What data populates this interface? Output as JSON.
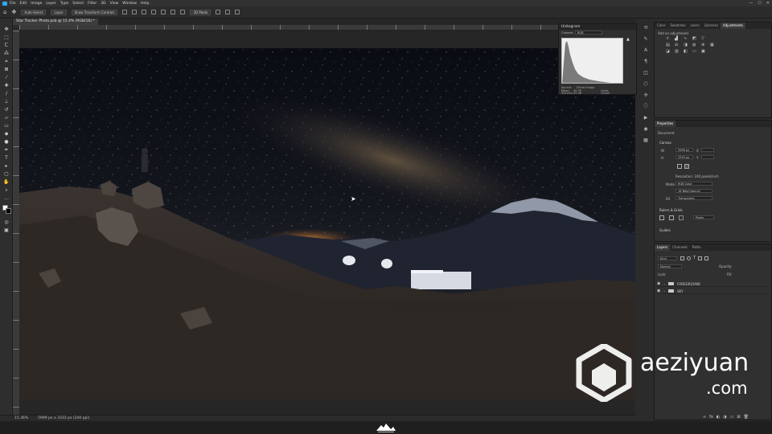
{
  "menu": {
    "items": [
      "File",
      "Edit",
      "Image",
      "Layer",
      "Type",
      "Select",
      "Filter",
      "3D",
      "View",
      "Window",
      "Help"
    ],
    "window_controls": [
      "—",
      "☐",
      "✕"
    ]
  },
  "options_bar": {
    "auto_select_label": "Auto-Select",
    "auto_select_value": "Layer",
    "transform_label": "Show Transform Controls",
    "mode_3d": "3D Mode"
  },
  "document": {
    "tab_title": "Star Tracker Photo.psb @ 15.4% (RGB/16) *",
    "zoom": "15.36%",
    "doc_size": "5999 px x 3333 px (240 ppi)"
  },
  "histogram": {
    "title": "Histogram",
    "channel_label": "Channel:",
    "channel_value": "RGB",
    "source_label": "Source:",
    "source_value": "Entire Image",
    "stats_left": [
      "Mean:",
      "Std Dev:",
      "Median:",
      "Pixels:"
    ],
    "stats_left_vals": [
      "40.35",
      "32.96",
      "31",
      "9996921"
    ],
    "stats_right": [
      "Level:",
      "Count:",
      "Percentile:",
      "Cache Level:"
    ],
    "stats_right_vals": [
      "",
      "",
      "",
      "6"
    ]
  },
  "adjustments": {
    "tabs": [
      "Color",
      "Swatches",
      "Learn",
      "Libraries",
      "Adjustments"
    ],
    "active_tab": "Adjustments",
    "add_label": "Add an adjustment"
  },
  "properties": {
    "title": "Properties",
    "doc_label": "Document",
    "canvas_title": "Canvas",
    "width_label": "W",
    "width_value": "5999 px",
    "height_label": "H",
    "height_value": "3333 px",
    "x_label": "X",
    "y_label": "Y",
    "resolution": "Resolution: 240 pixels/inch",
    "mode_label": "Mode",
    "mode_value": "RGB Color",
    "depth_value": "16 Bits/Channel",
    "fill_label": "Fill",
    "fill_value": "Transparent",
    "rulers_title": "Rulers & Grids",
    "units_value": "Pixels",
    "guides_title": "Guides"
  },
  "layers": {
    "tabs": [
      "Layers",
      "Channels",
      "Paths"
    ],
    "active_tab": "Layers",
    "kind_label": "Kind",
    "blend_value": "Normal",
    "opacity_label": "Opacity:",
    "fill_label": "Fill:",
    "lock_label": "Lock:",
    "rows": [
      {
        "name": "FOREGROUND",
        "type": "group"
      },
      {
        "name": "SKY",
        "type": "group"
      }
    ]
  },
  "watermark": {
    "line1": "aeziyuan",
    "line2": ".com"
  },
  "tools": [
    "move",
    "marquee",
    "lasso",
    "magic-wand",
    "crop",
    "frame",
    "eyedropper",
    "healing",
    "brush",
    "clone-stamp",
    "history-brush",
    "eraser",
    "gradient",
    "blur",
    "dodge",
    "pen",
    "type",
    "path-select",
    "rectangle",
    "hand",
    "zoom",
    "more"
  ],
  "colors": {
    "accent": "#31a8ff",
    "panel_bg": "#303030",
    "app_bg": "#2b2b2b"
  }
}
